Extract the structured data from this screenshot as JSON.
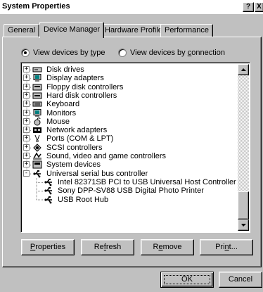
{
  "window": {
    "title": "System Properties",
    "help_button": "?",
    "close_button": "X"
  },
  "tabs": [
    {
      "label": "General",
      "active": false
    },
    {
      "label": "Device Manager",
      "active": true
    },
    {
      "label": "Hardware Profiles",
      "active": false
    },
    {
      "label": "Performance",
      "active": false
    }
  ],
  "view_options": {
    "by_type": {
      "pre": "View devices by ",
      "key": "t",
      "post": "ype",
      "checked": true
    },
    "by_connection": {
      "pre": "View devices by ",
      "key": "c",
      "post": "onnection",
      "checked": false
    }
  },
  "tree": [
    {
      "label": "Disk drives",
      "icon": "disk-drive-icon",
      "level": 0,
      "expander": "+"
    },
    {
      "label": "Display adapters",
      "icon": "monitor-icon",
      "level": 0,
      "expander": "+"
    },
    {
      "label": "Floppy disk controllers",
      "icon": "floppy-controller-icon",
      "level": 0,
      "expander": "+"
    },
    {
      "label": "Hard disk controllers",
      "icon": "hard-disk-controller-icon",
      "level": 0,
      "expander": "+"
    },
    {
      "label": "Keyboard",
      "icon": "keyboard-icon",
      "level": 0,
      "expander": "+"
    },
    {
      "label": "Monitors",
      "icon": "monitor-icon",
      "level": 0,
      "expander": "+"
    },
    {
      "label": "Mouse",
      "icon": "mouse-icon",
      "level": 0,
      "expander": "+"
    },
    {
      "label": "Network adapters",
      "icon": "network-adapter-icon",
      "level": 0,
      "expander": "+"
    },
    {
      "label": "Ports (COM & LPT)",
      "icon": "port-icon",
      "level": 0,
      "expander": "+"
    },
    {
      "label": "SCSI controllers",
      "icon": "scsi-icon",
      "level": 0,
      "expander": "+"
    },
    {
      "label": "Sound, video and game controllers",
      "icon": "sound-video-icon",
      "level": 0,
      "expander": "+"
    },
    {
      "label": "System devices",
      "icon": "system-device-icon",
      "level": 0,
      "expander": "+"
    },
    {
      "label": "Universal serial bus controller",
      "icon": "usb-icon",
      "level": 0,
      "expander": "-"
    },
    {
      "label": "Intel 82371SB PCI to USB Universal Host Controller",
      "icon": "usb-icon",
      "level": 1,
      "expander": ""
    },
    {
      "label": "Sony DPP-SV88 USB Digital Photo Printer",
      "icon": "usb-icon",
      "level": 1,
      "expander": ""
    },
    {
      "label": "USB Root Hub",
      "icon": "usb-icon",
      "level": 1,
      "expander": ""
    }
  ],
  "buttons": {
    "properties": {
      "key": "P",
      "rest": "roperties"
    },
    "refresh": {
      "pre": "Re",
      "key": "f",
      "post": "resh"
    },
    "remove": {
      "pre": "R",
      "key": "e",
      "post": "move"
    },
    "print": {
      "pre": "Pri",
      "key": "n",
      "post": "t..."
    },
    "ok": "OK",
    "cancel": "Cancel"
  },
  "colors": {
    "face": "#c0c0c0",
    "shadow": "#808080",
    "highlight": "#ffffff"
  }
}
